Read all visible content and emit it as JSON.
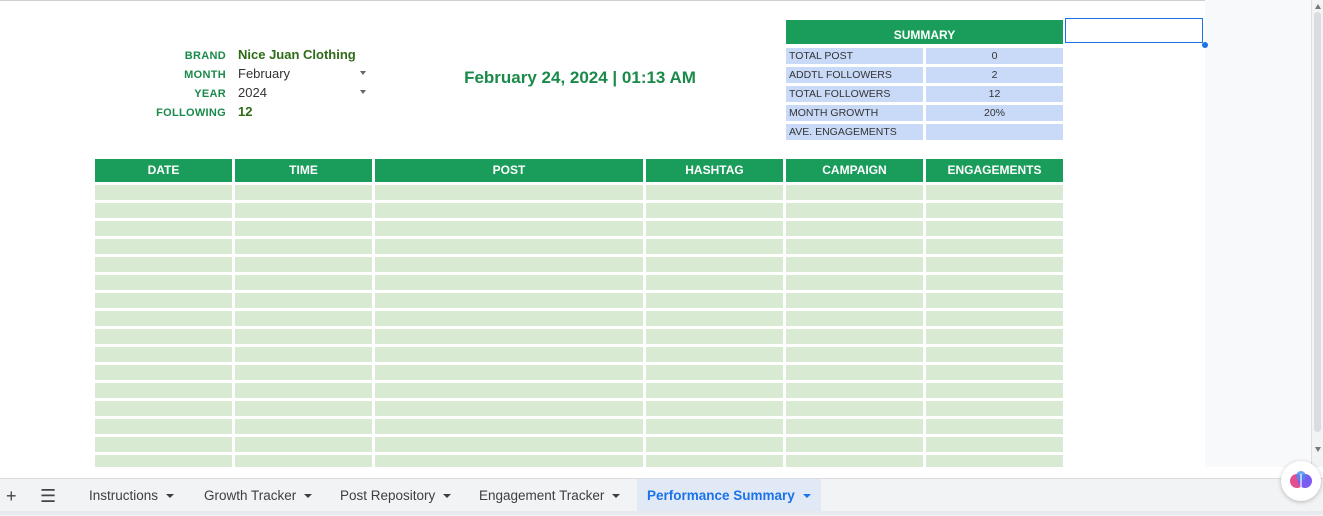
{
  "info": {
    "brand_label": "BRAND",
    "brand_value": "Nice Juan Clothing",
    "month_label": "MONTH",
    "month_value": "February",
    "year_label": "YEAR",
    "year_value": "2024",
    "following_label": "FOLLOWING",
    "following_value": "12"
  },
  "datetime": "February 24, 2024 | 01:13 AM",
  "summary": {
    "title": "SUMMARY",
    "rows": [
      {
        "label": "TOTAL POST",
        "value": "0"
      },
      {
        "label": "ADDTL FOLLOWERS",
        "value": "2"
      },
      {
        "label": "TOTAL FOLLOWERS",
        "value": "12"
      },
      {
        "label": "MONTH GROWTH",
        "value": "20%"
      },
      {
        "label": "AVE. ENGAGEMENTS",
        "value": ""
      }
    ]
  },
  "table": {
    "headers": [
      "DATE",
      "TIME",
      "POST",
      "HASHTAG",
      "CAMPAIGN",
      "ENGAGEMENTS"
    ]
  },
  "tabs": [
    {
      "label": "Instructions"
    },
    {
      "label": "Growth Tracker"
    },
    {
      "label": "Post Repository"
    },
    {
      "label": "Engagement Tracker"
    },
    {
      "label": "Performance Summary"
    }
  ],
  "icons": {
    "add_sheet": "plus-icon",
    "all_sheets": "menu-icon",
    "assistant": "gemini-icon"
  },
  "colors": {
    "header_green": "#1a9d5a",
    "row_green": "#d9ead3",
    "summary_blue": "#c9daf8",
    "accent_text_green": "#1a8a4a",
    "active_tab_blue": "#1a73e8"
  }
}
